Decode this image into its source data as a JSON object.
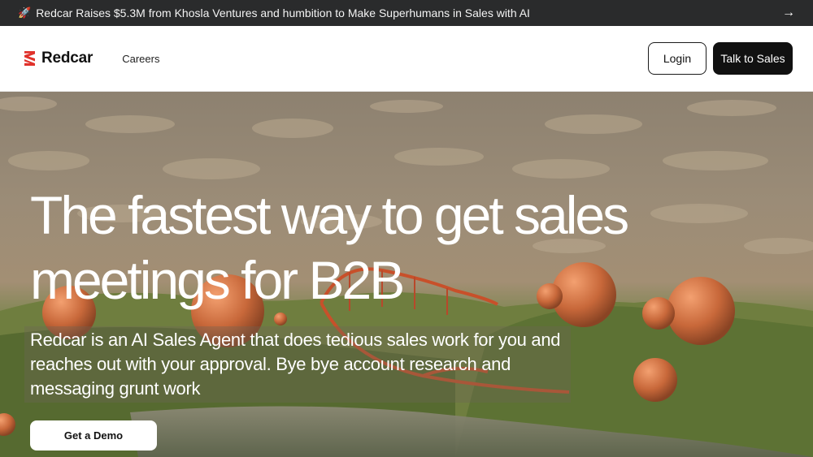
{
  "announcement": {
    "icon": "rocket-icon",
    "text": "Redcar Raises $5.3M from Khosla Ventures and humbition to Make Superhumans in Sales with AI",
    "arrow_icon": "arrow-right-icon"
  },
  "nav": {
    "brand": "Redcar",
    "brand_color": "#e0322b",
    "links": [
      "Careers"
    ],
    "login_label": "Login",
    "sales_label": "Talk to Sales"
  },
  "hero": {
    "title_line1": "The fastest way to get sales",
    "title_line2": "meetings for B2B",
    "subtitle": "Redcar is an AI Sales Agent that does tedious sales work for you and reaches out with your approval. Bye bye account research and messaging grunt work",
    "cta_label": "Get a Demo"
  }
}
